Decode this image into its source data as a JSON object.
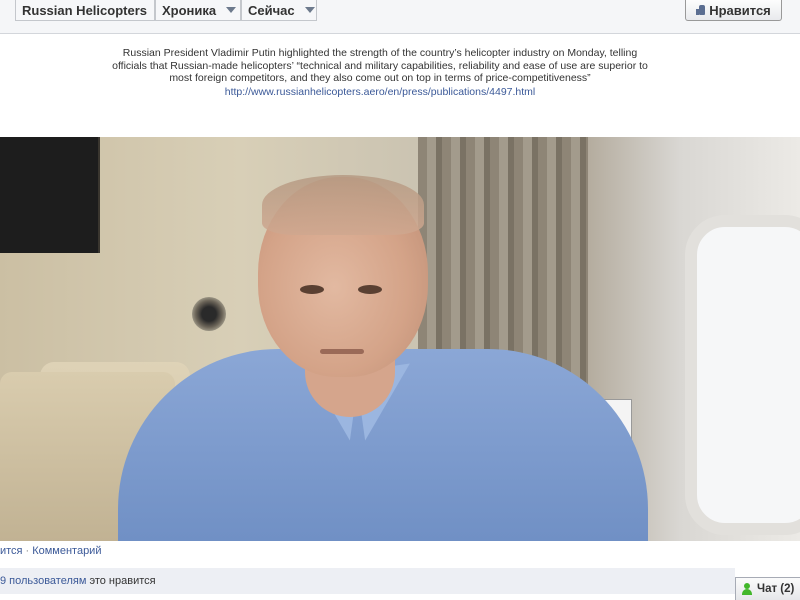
{
  "topbar": {
    "page_name": "Russian Helicopters",
    "timeline_label": "Хроника",
    "now_label": "Сейчас",
    "like_button": "Нравится"
  },
  "post": {
    "caption": "Russian President Vladimir Putin highlighted the strength of the country’s helicopter industry on Monday, telling officials that Russian-made helicopters’ “technical and military capabilities, reliability and ease of use are superior to most foreign competitors, and they also come out on top in terms of price-competitiveness”",
    "link": "http://www.russianhelicopters.aero/en/press/publications/4497.html"
  },
  "actions": {
    "like_partial": "ится",
    "separator": "·",
    "comment": "Комментарий"
  },
  "likes": {
    "count_partial": "9 пользователям",
    "suffix": " это нравится"
  },
  "chat": {
    "label": "Чат (2)"
  },
  "colors": {
    "link": "#3b5998",
    "topbar_bg": "#f5f6f8",
    "likes_bg": "#edeff4",
    "chat_status": "#42b72a"
  }
}
